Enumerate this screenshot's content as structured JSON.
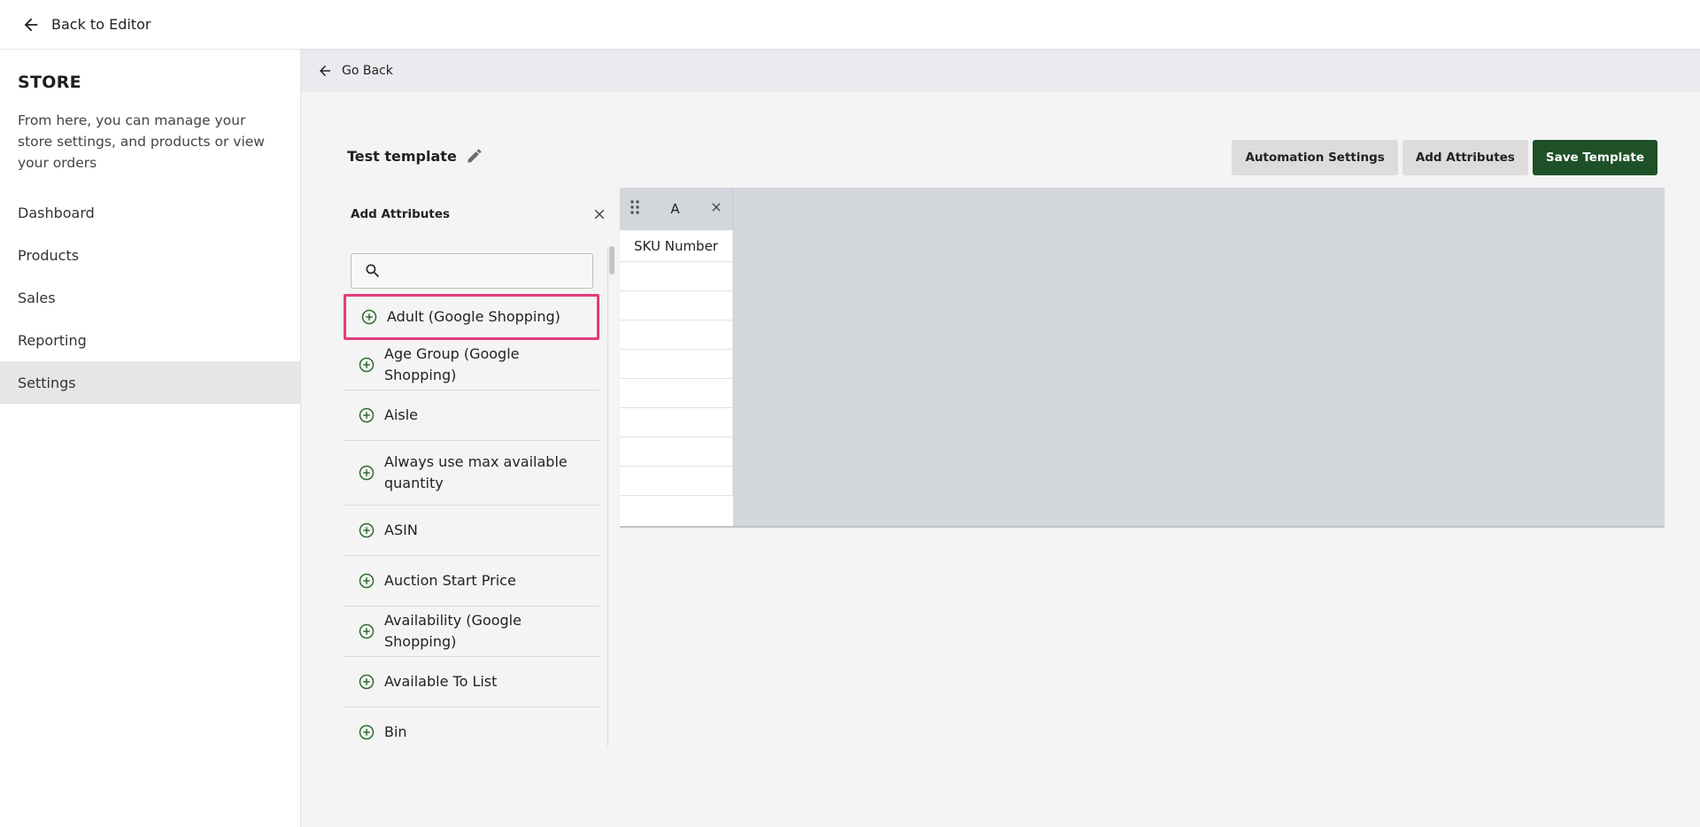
{
  "topbar": {
    "back_label": "Back to Editor"
  },
  "sidebar": {
    "title": "STORE",
    "description": "From here, you can manage your store settings, and products or view your orders",
    "items": [
      {
        "label": "Dashboard"
      },
      {
        "label": "Products"
      },
      {
        "label": "Sales"
      },
      {
        "label": "Reporting"
      },
      {
        "label": "Settings",
        "active": true
      }
    ]
  },
  "main": {
    "go_back_label": "Go Back",
    "template_title": "Test template",
    "buttons": {
      "automation": "Automation Settings",
      "add_attributes": "Add Attributes",
      "save": "Save Template"
    }
  },
  "attributes_panel": {
    "title": "Add Attributes",
    "search": {
      "value": "",
      "placeholder": ""
    },
    "items": [
      {
        "label": "Adult (Google Shopping)",
        "highlighted": true
      },
      {
        "label": "Age Group (Google Shopping)"
      },
      {
        "label": "Aisle"
      },
      {
        "label": "Always use max available quantity"
      },
      {
        "label": "ASIN"
      },
      {
        "label": "Auction Start Price"
      },
      {
        "label": "Availability (Google Shopping)"
      },
      {
        "label": "Available To List"
      },
      {
        "label": "Bin"
      }
    ]
  },
  "grid": {
    "column": {
      "letter": "A",
      "first_cell": "SKU Number"
    }
  },
  "colors": {
    "accent_green": "#1e5128",
    "highlight_pink": "#e23c7c",
    "plus_icon_green": "#2e6b2e"
  }
}
